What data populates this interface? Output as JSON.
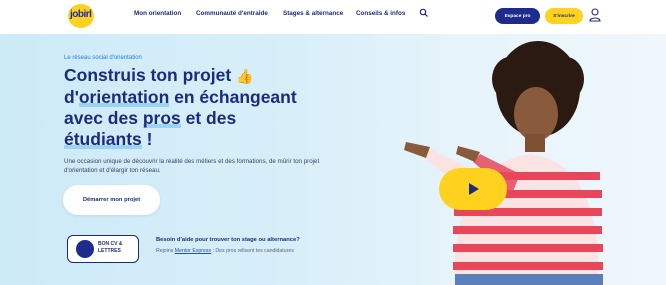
{
  "logo": {
    "text": "jobirl",
    "subtitle": ""
  },
  "nav": {
    "links": [
      "Mon orientation",
      "Communauté d'entraide",
      "Stages & alternance",
      "Conseils & infos"
    ],
    "search_icon": "search-icon",
    "pro_button": "Espace pro",
    "signup_button": "S'inscrire",
    "user_icon": "user-icon"
  },
  "hero": {
    "tag": "Le réseau social d'orientation",
    "title": {
      "line1_a": "Construis ton projet",
      "line1_emoji": "👍",
      "line2_a": "d'",
      "line2_hl": "orientation",
      "line2_b": " en échangeant",
      "line3_a": "avec des ",
      "line3_hl": "pros",
      "line3_b": " et des",
      "line4_hl": "étudiants",
      "line4_b": " !"
    },
    "description": "Une occasion unique de découvrir la réalité des métiers et des formations, de mûrir ton projet d'orientation et d'élargir ton réseau.",
    "cta": "Démarrer mon projet",
    "badge": "BON CV & LETTRES",
    "help_title": "Besoin d'aide pour trouver ton stage ou alternance?",
    "help_text_before": "Rejoins ",
    "help_link": "Mentor Express",
    "help_text_after": " : Des pros relisent tes candidatures",
    "play_icon": "play-icon"
  },
  "colors": {
    "navy": "#1d2b7c",
    "yellow": "#ffd21f",
    "hero_bg": "#cdeaf7",
    "accent_blue": "#2a7de1"
  }
}
